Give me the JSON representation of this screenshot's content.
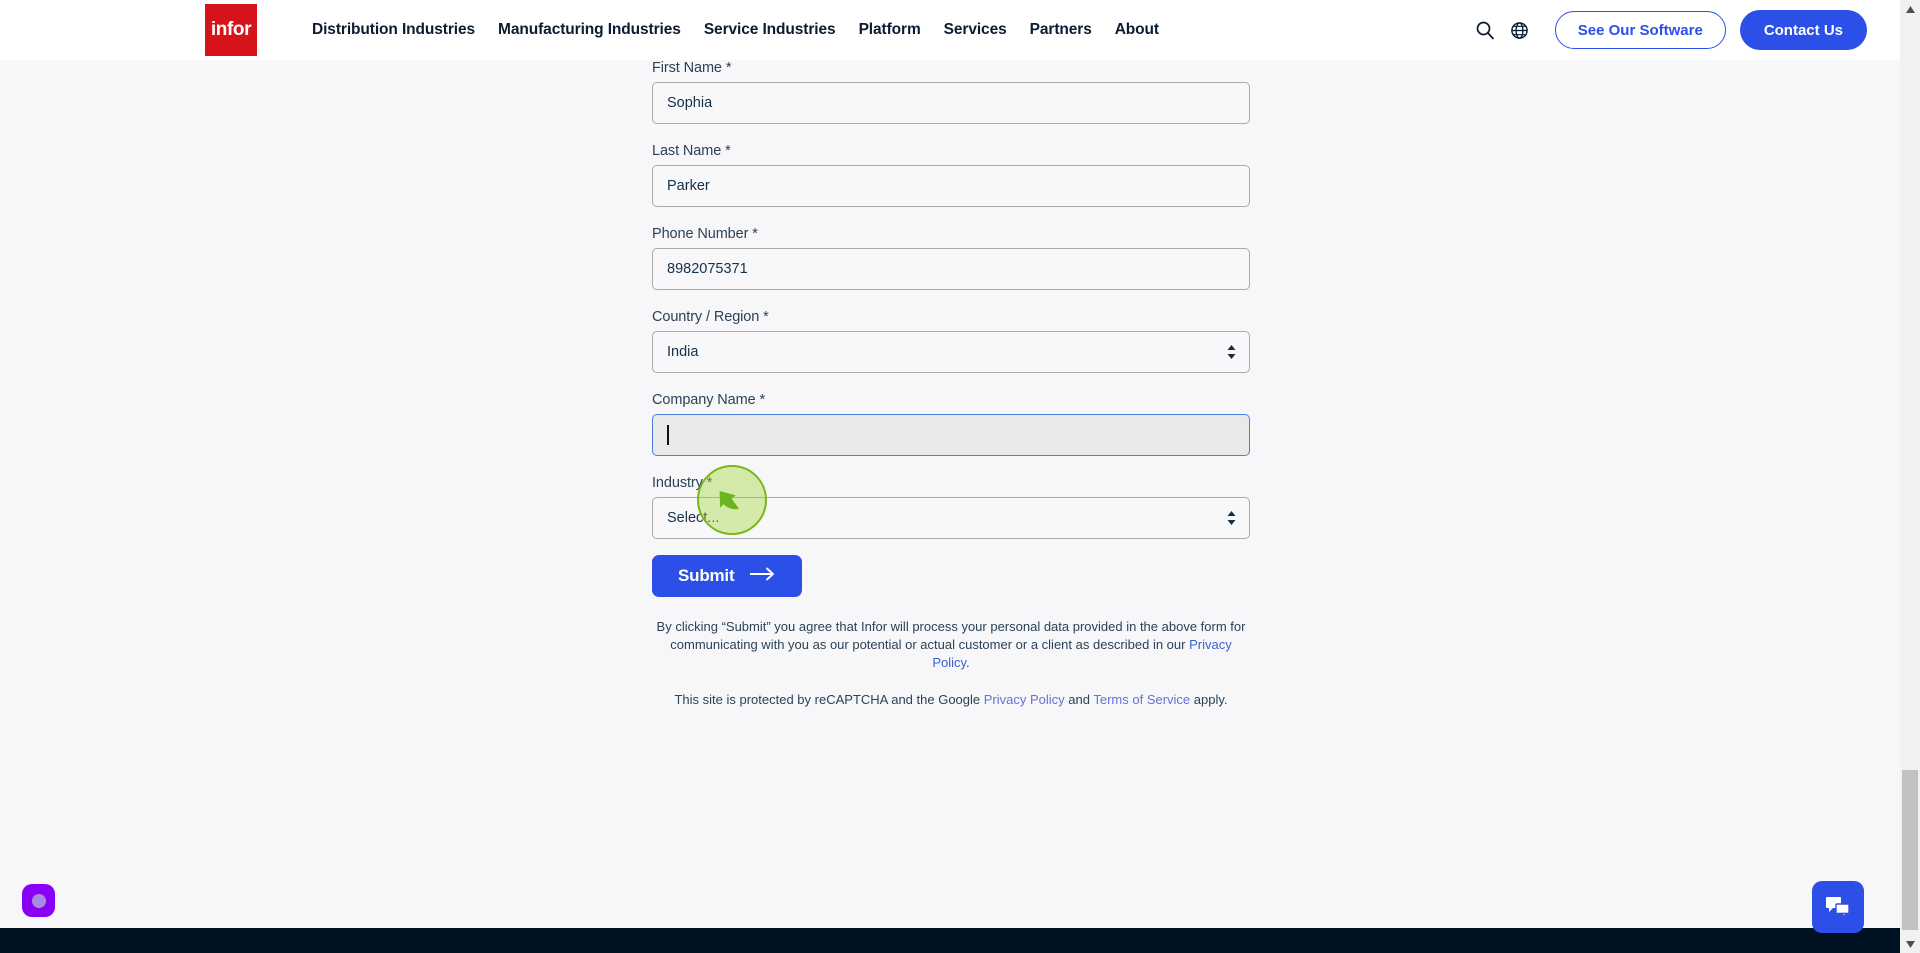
{
  "header": {
    "logo_text": "infor",
    "nav_items": [
      {
        "label": "Distribution Industries"
      },
      {
        "label": "Manufacturing Industries"
      },
      {
        "label": "Service Industries"
      },
      {
        "label": "Platform"
      },
      {
        "label": "Services"
      },
      {
        "label": "Partners"
      },
      {
        "label": "About"
      }
    ],
    "search_icon": "search-icon",
    "language_icon": "globe-icon",
    "see_software_label": "See Our Software",
    "contact_us_label": "Contact Us"
  },
  "form": {
    "fields": [
      {
        "label": "First Name",
        "required_mark": "*",
        "value": "Sophia",
        "type": "text",
        "name": "first-name"
      },
      {
        "label": "Last Name",
        "required_mark": "*",
        "value": "Parker",
        "type": "text",
        "name": "last-name"
      },
      {
        "label": "Phone Number",
        "required_mark": "*",
        "value": "8982075371",
        "type": "text",
        "name": "phone-number"
      },
      {
        "label": "Country / Region",
        "required_mark": "*",
        "value": "India",
        "type": "select",
        "name": "country-region"
      },
      {
        "label": "Company Name",
        "required_mark": "*",
        "value": "",
        "placeholder": "",
        "type": "text",
        "name": "company-name",
        "focused": true
      },
      {
        "label": "Industry",
        "required_mark": "*",
        "value": "Select...",
        "type": "select",
        "name": "industry"
      }
    ],
    "submit_label": "Submit",
    "submit_arrow": "arrow-right-icon"
  },
  "legal": {
    "consent_text_part1": "By clicking “Submit” you agree that Infor will process your personal data provided in the above form for communicating with you as our potential or actual customer or a client as described in our ",
    "privacy_policy_link": "Privacy Policy",
    "consent_text_part2": ".",
    "recaptcha_prefix": "This site is protected by reCAPTCHA and the Google ",
    "recaptcha_privacy_link": "Privacy Policy",
    "recaptcha_conjunction": " and ",
    "recaptcha_terms_link": "Terms of Service",
    "recaptcha_suffix": " apply."
  },
  "widgets": {
    "accessibility_icon": "accessibility-widget-icon",
    "chat_icon": "chat-bubble-icon"
  },
  "colors": {
    "brand_red": "#d6131b",
    "brand_blue": "#2c4fe8",
    "page_bg": "#f7f7fa",
    "footer_dark": "#001122",
    "focus_border": "#4a7fe0",
    "focused_field_bg": "#e9e9e9",
    "cursor_highlight": "#7cb518",
    "accessibility_purple": "#8a00f5",
    "link_blue": "#3b5fd4"
  }
}
